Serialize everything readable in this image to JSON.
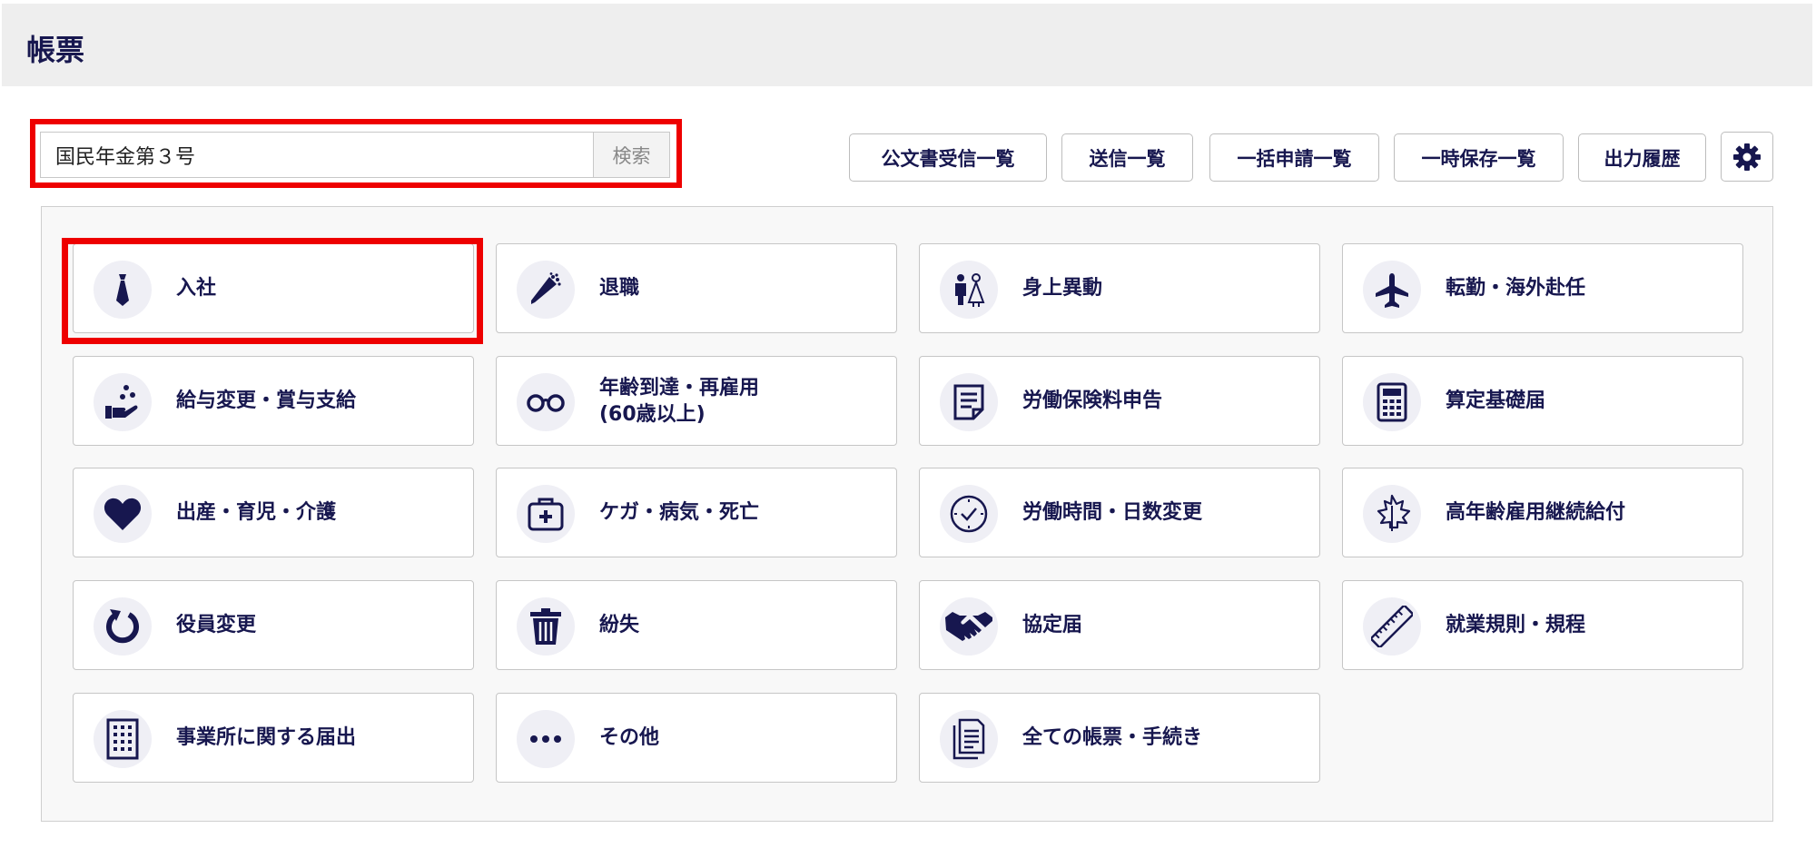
{
  "header": {
    "title": "帳票"
  },
  "search": {
    "value": "国民年金第３号",
    "button_label": "検索"
  },
  "toolbar": {
    "buttons": [
      {
        "label": "公文書受信一覧"
      },
      {
        "label": "送信一覧"
      },
      {
        "label": "一括申請一覧"
      },
      {
        "label": "一時保存一覧"
      },
      {
        "label": "出力履歴"
      }
    ]
  },
  "cards": [
    {
      "label": "入社",
      "icon": "necktie-icon"
    },
    {
      "label": "退職",
      "icon": "bouquet-icon"
    },
    {
      "label": "身上異動",
      "icon": "wedding-couple-icon"
    },
    {
      "label": "転勤・海外赴任",
      "icon": "airplane-icon"
    },
    {
      "label": "給与変更・賞与支給",
      "icon": "hand-coins-icon"
    },
    {
      "label": "年齢到達・再雇用\n(60歳以上)",
      "icon": "glasses-icon"
    },
    {
      "label": "労働保険料申告",
      "icon": "document-icon"
    },
    {
      "label": "算定基礎届",
      "icon": "calculator-icon"
    },
    {
      "label": "出産・育児・介護",
      "icon": "heart-icon"
    },
    {
      "label": "ケガ・病気・死亡",
      "icon": "first-aid-kit-icon"
    },
    {
      "label": "労働時間・日数変更",
      "icon": "clock-icon"
    },
    {
      "label": "高年齢雇用継続給付",
      "icon": "maple-leaf-icon"
    },
    {
      "label": "役員変更",
      "icon": "refresh-icon"
    },
    {
      "label": "紛失",
      "icon": "trash-icon"
    },
    {
      "label": "協定届",
      "icon": "handshake-icon"
    },
    {
      "label": "就業規則・規程",
      "icon": "ruler-icon"
    },
    {
      "label": "事業所に関する届出",
      "icon": "building-icon"
    },
    {
      "label": "その他",
      "icon": "more-dots-icon"
    },
    {
      "label": "全ての帳票・手続き",
      "icon": "documents-icon"
    }
  ],
  "colors": {
    "accent": "#17174f",
    "highlight": "#ee0000",
    "icon_bg": "#efeff5"
  }
}
